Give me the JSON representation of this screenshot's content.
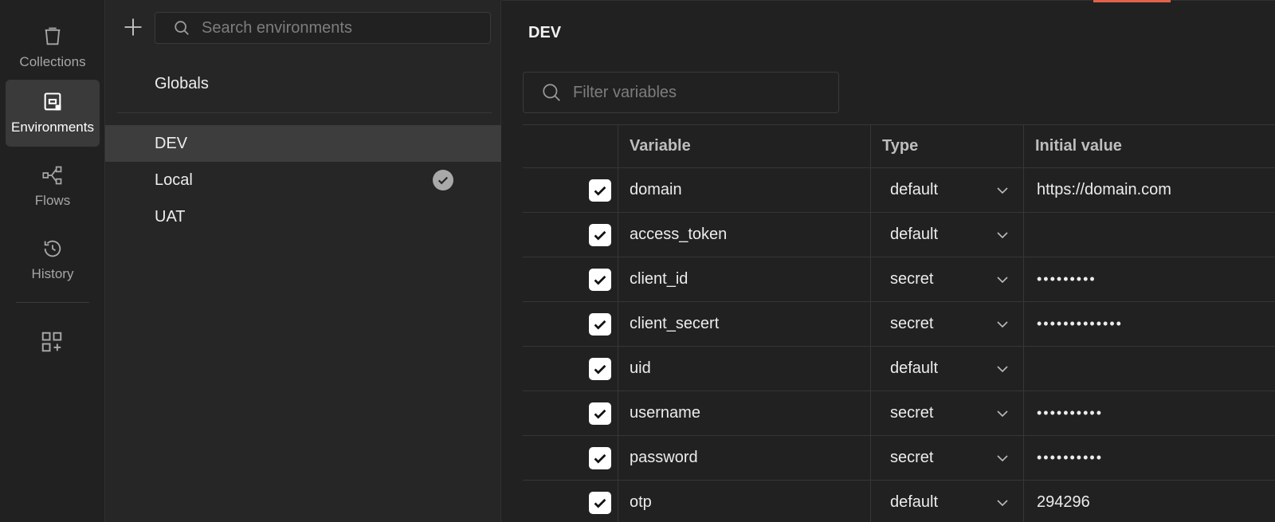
{
  "rail": {
    "items": [
      {
        "label": "Collections",
        "icon": "trash-bin-icon",
        "active": false
      },
      {
        "label": "Environments",
        "icon": "environment-icon",
        "active": true
      },
      {
        "label": "Flows",
        "icon": "flows-icon",
        "active": false
      },
      {
        "label": "History",
        "icon": "history-icon",
        "active": false
      }
    ],
    "apps_icon": "apps-add-icon"
  },
  "env_panel": {
    "search_placeholder": "Search environments",
    "globals_label": "Globals",
    "environments": [
      {
        "name": "DEV",
        "selected": true,
        "active": false
      },
      {
        "name": "Local",
        "selected": false,
        "active": true
      },
      {
        "name": "UAT",
        "selected": false,
        "active": false
      }
    ]
  },
  "main": {
    "title": "DEV",
    "filter_placeholder": "Filter variables",
    "columns": {
      "variable": "Variable",
      "type": "Type",
      "initial": "Initial value"
    },
    "variables": [
      {
        "name": "domain",
        "type": "default",
        "initial": "https://domain.com"
      },
      {
        "name": "access_token",
        "type": "default",
        "initial": ""
      },
      {
        "name": "client_id",
        "type": "secret",
        "initial": "•••••••••"
      },
      {
        "name": "client_secert",
        "type": "secret",
        "initial": "•••••••••••••"
      },
      {
        "name": "uid",
        "type": "default",
        "initial": ""
      },
      {
        "name": "username",
        "type": "secret",
        "initial": "••••••••••"
      },
      {
        "name": "password",
        "type": "secret",
        "initial": "••••••••••"
      },
      {
        "name": "otp",
        "type": "default",
        "initial": "294296"
      }
    ]
  },
  "colors": {
    "accent": "#e0624a",
    "rail_active": "#3a3a3a",
    "selected_row": "#3d3d3d"
  }
}
